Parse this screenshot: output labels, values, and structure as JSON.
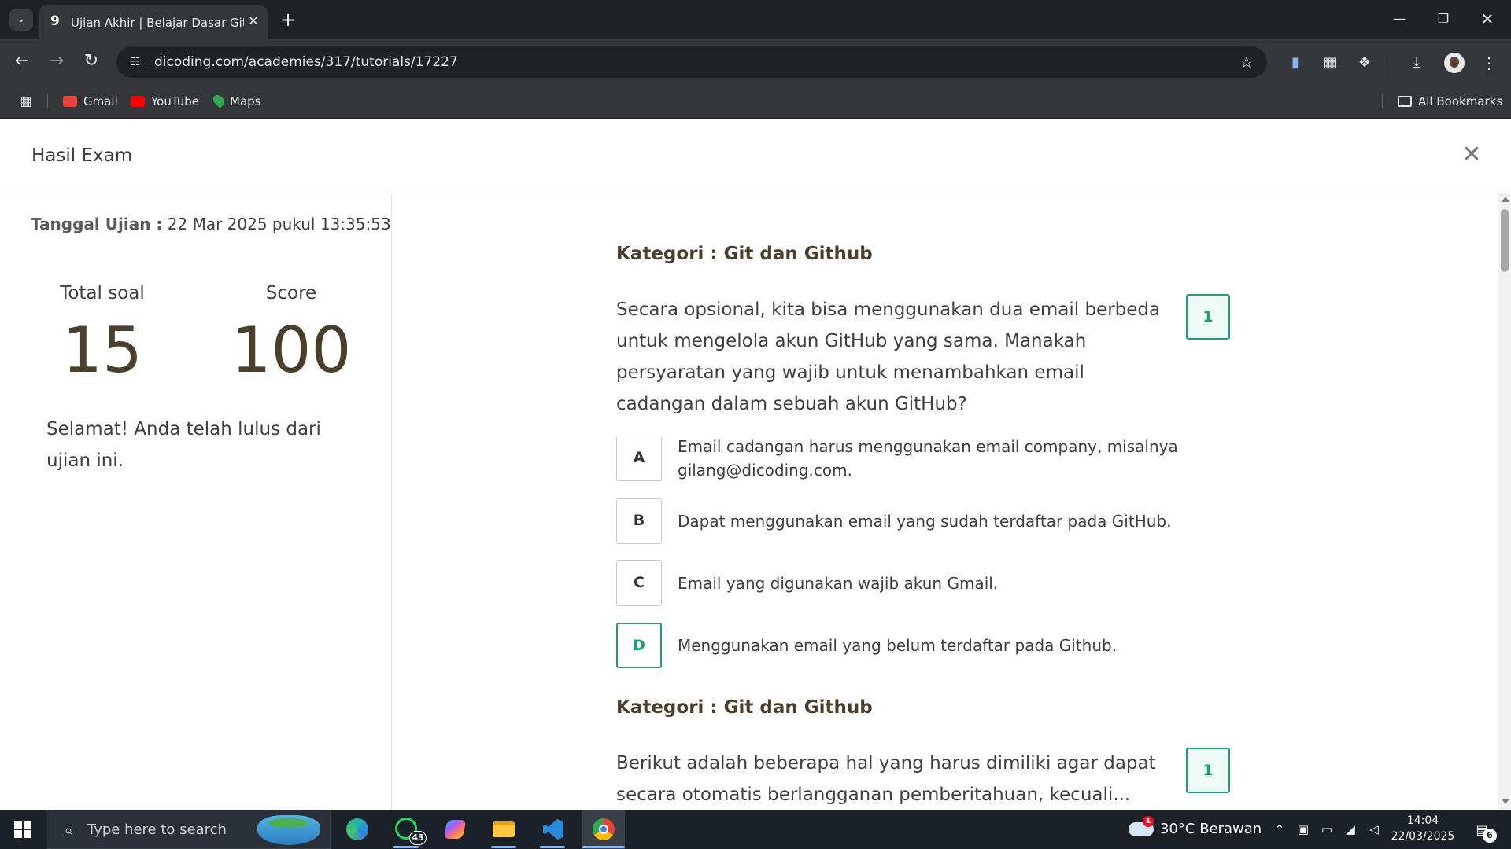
{
  "browser": {
    "tab": {
      "title": "Ujian Akhir | Belajar Dasar Git dengan GitHub",
      "favicon": "dicoding-icon"
    },
    "url": "dicoding.com/academies/317/tutorials/17227",
    "bookmarks": [
      {
        "label": "Gmail",
        "icon": "gmail-icon"
      },
      {
        "label": "YouTube",
        "icon": "youtube-icon"
      },
      {
        "label": "Maps",
        "icon": "maps-icon"
      }
    ],
    "all_bookmarks_label": "All Bookmarks"
  },
  "page": {
    "title": "Hasil Exam"
  },
  "summary": {
    "date_label": "Tanggal Ujian :",
    "date_value": "22 Mar 2025 pukul 13:35:53",
    "total_label": "Total soal",
    "total_value": "15",
    "score_label": "Score",
    "score_value": "100",
    "message": "Selamat! Anda telah lulus dari ujian ini."
  },
  "questions": [
    {
      "category": "Kategori : Git dan Github",
      "text": "Secara opsional, kita bisa menggunakan dua email berbeda untuk mengelola akun GitHub yang sama. Manakah persyaratan yang wajib untuk menambahkan email cadangan dalam sebuah akun GitHub?",
      "points": "1",
      "options": [
        {
          "letter": "A",
          "text": "Email cadangan harus menggunakan email company, misalnya gilang@dicoding.com.",
          "correct": false
        },
        {
          "letter": "B",
          "text": "Dapat menggunakan email yang sudah terdaftar pada GitHub.",
          "correct": false
        },
        {
          "letter": "C",
          "text": "Email yang digunakan wajib akun Gmail.",
          "correct": false
        },
        {
          "letter": "D",
          "text": "Menggunakan email yang belum terdaftar pada Github.",
          "correct": true
        }
      ]
    },
    {
      "category": "Kategori : Git dan Github",
      "text": "Berikut adalah beberapa hal yang harus dimiliki agar dapat secara otomatis berlangganan pemberitahuan, kecuali...",
      "points": "1"
    }
  ],
  "taskbar": {
    "search_placeholder": "Type here to search",
    "whatsapp_badge": "43",
    "weather_badge": "1",
    "weather": "30°C  Berawan",
    "time": "14:04",
    "date": "22/03/2025",
    "notification_count": "6"
  },
  "colors": {
    "accent": "#16a37a",
    "heading": "#4a3f2c",
    "chrome_dark": "#202124",
    "chrome_toolbar": "#35363a",
    "taskbar": "#1c2027"
  }
}
